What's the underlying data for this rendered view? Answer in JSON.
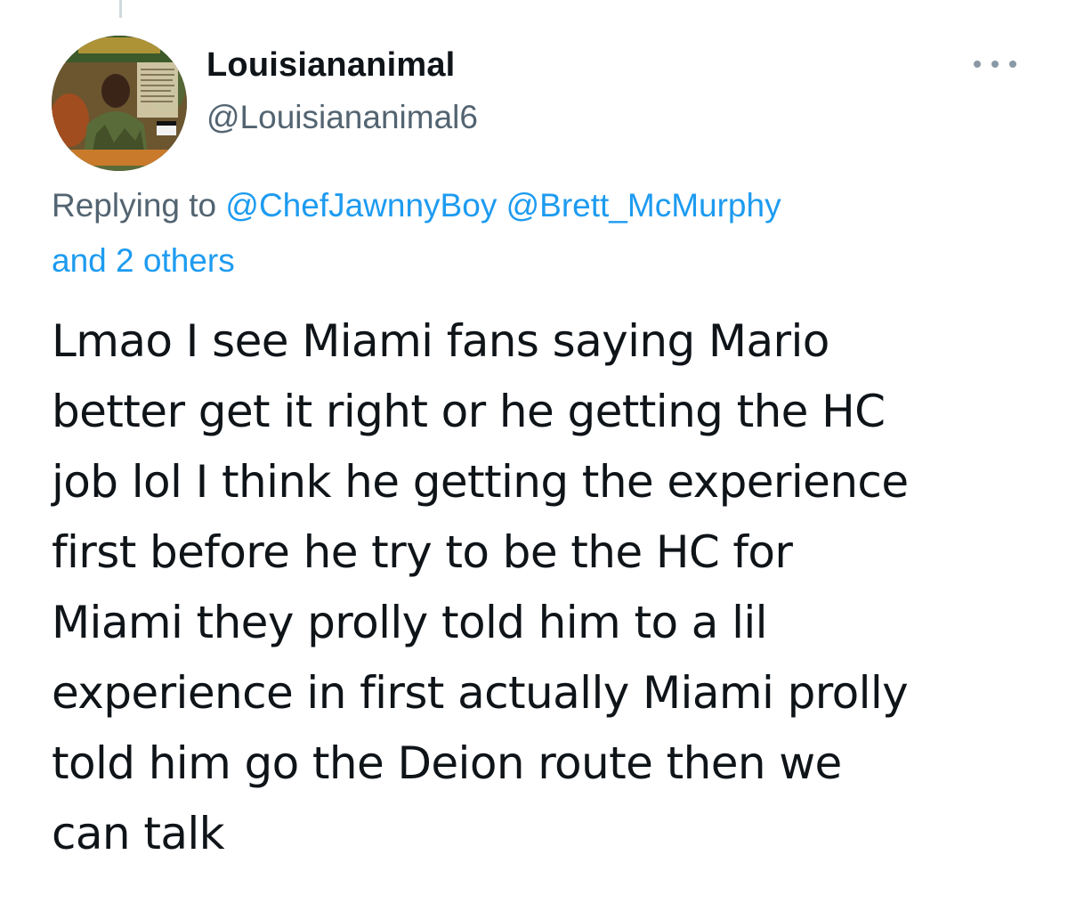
{
  "tweet": {
    "author": {
      "display_name": "Louisiananimal",
      "handle": "@Louisiananimal6",
      "avatar_icon": "album-cover-avatar"
    },
    "more_icon": "more-horizontal-icon",
    "reply_context": {
      "prefix": "Replying to",
      "mentions": [
        "@ChefJawnnyBoy",
        "@Brett_McMurphy"
      ],
      "others": "and 2 others"
    },
    "text_lines": [
      "Lmao I see Miami fans saying Mario",
      "better get it right or he getting the HC",
      "job lol I think he getting the experience",
      "first before he try to be the HC for",
      "Miami they prolly told him to a lil",
      "experience in first actually Miami prolly",
      "told him go the Deion route then we",
      "can talk"
    ]
  },
  "colors": {
    "text": "#0f1419",
    "secondary": "#536471",
    "link": "#1d9bf0",
    "thread_line": "#cfd9de"
  }
}
